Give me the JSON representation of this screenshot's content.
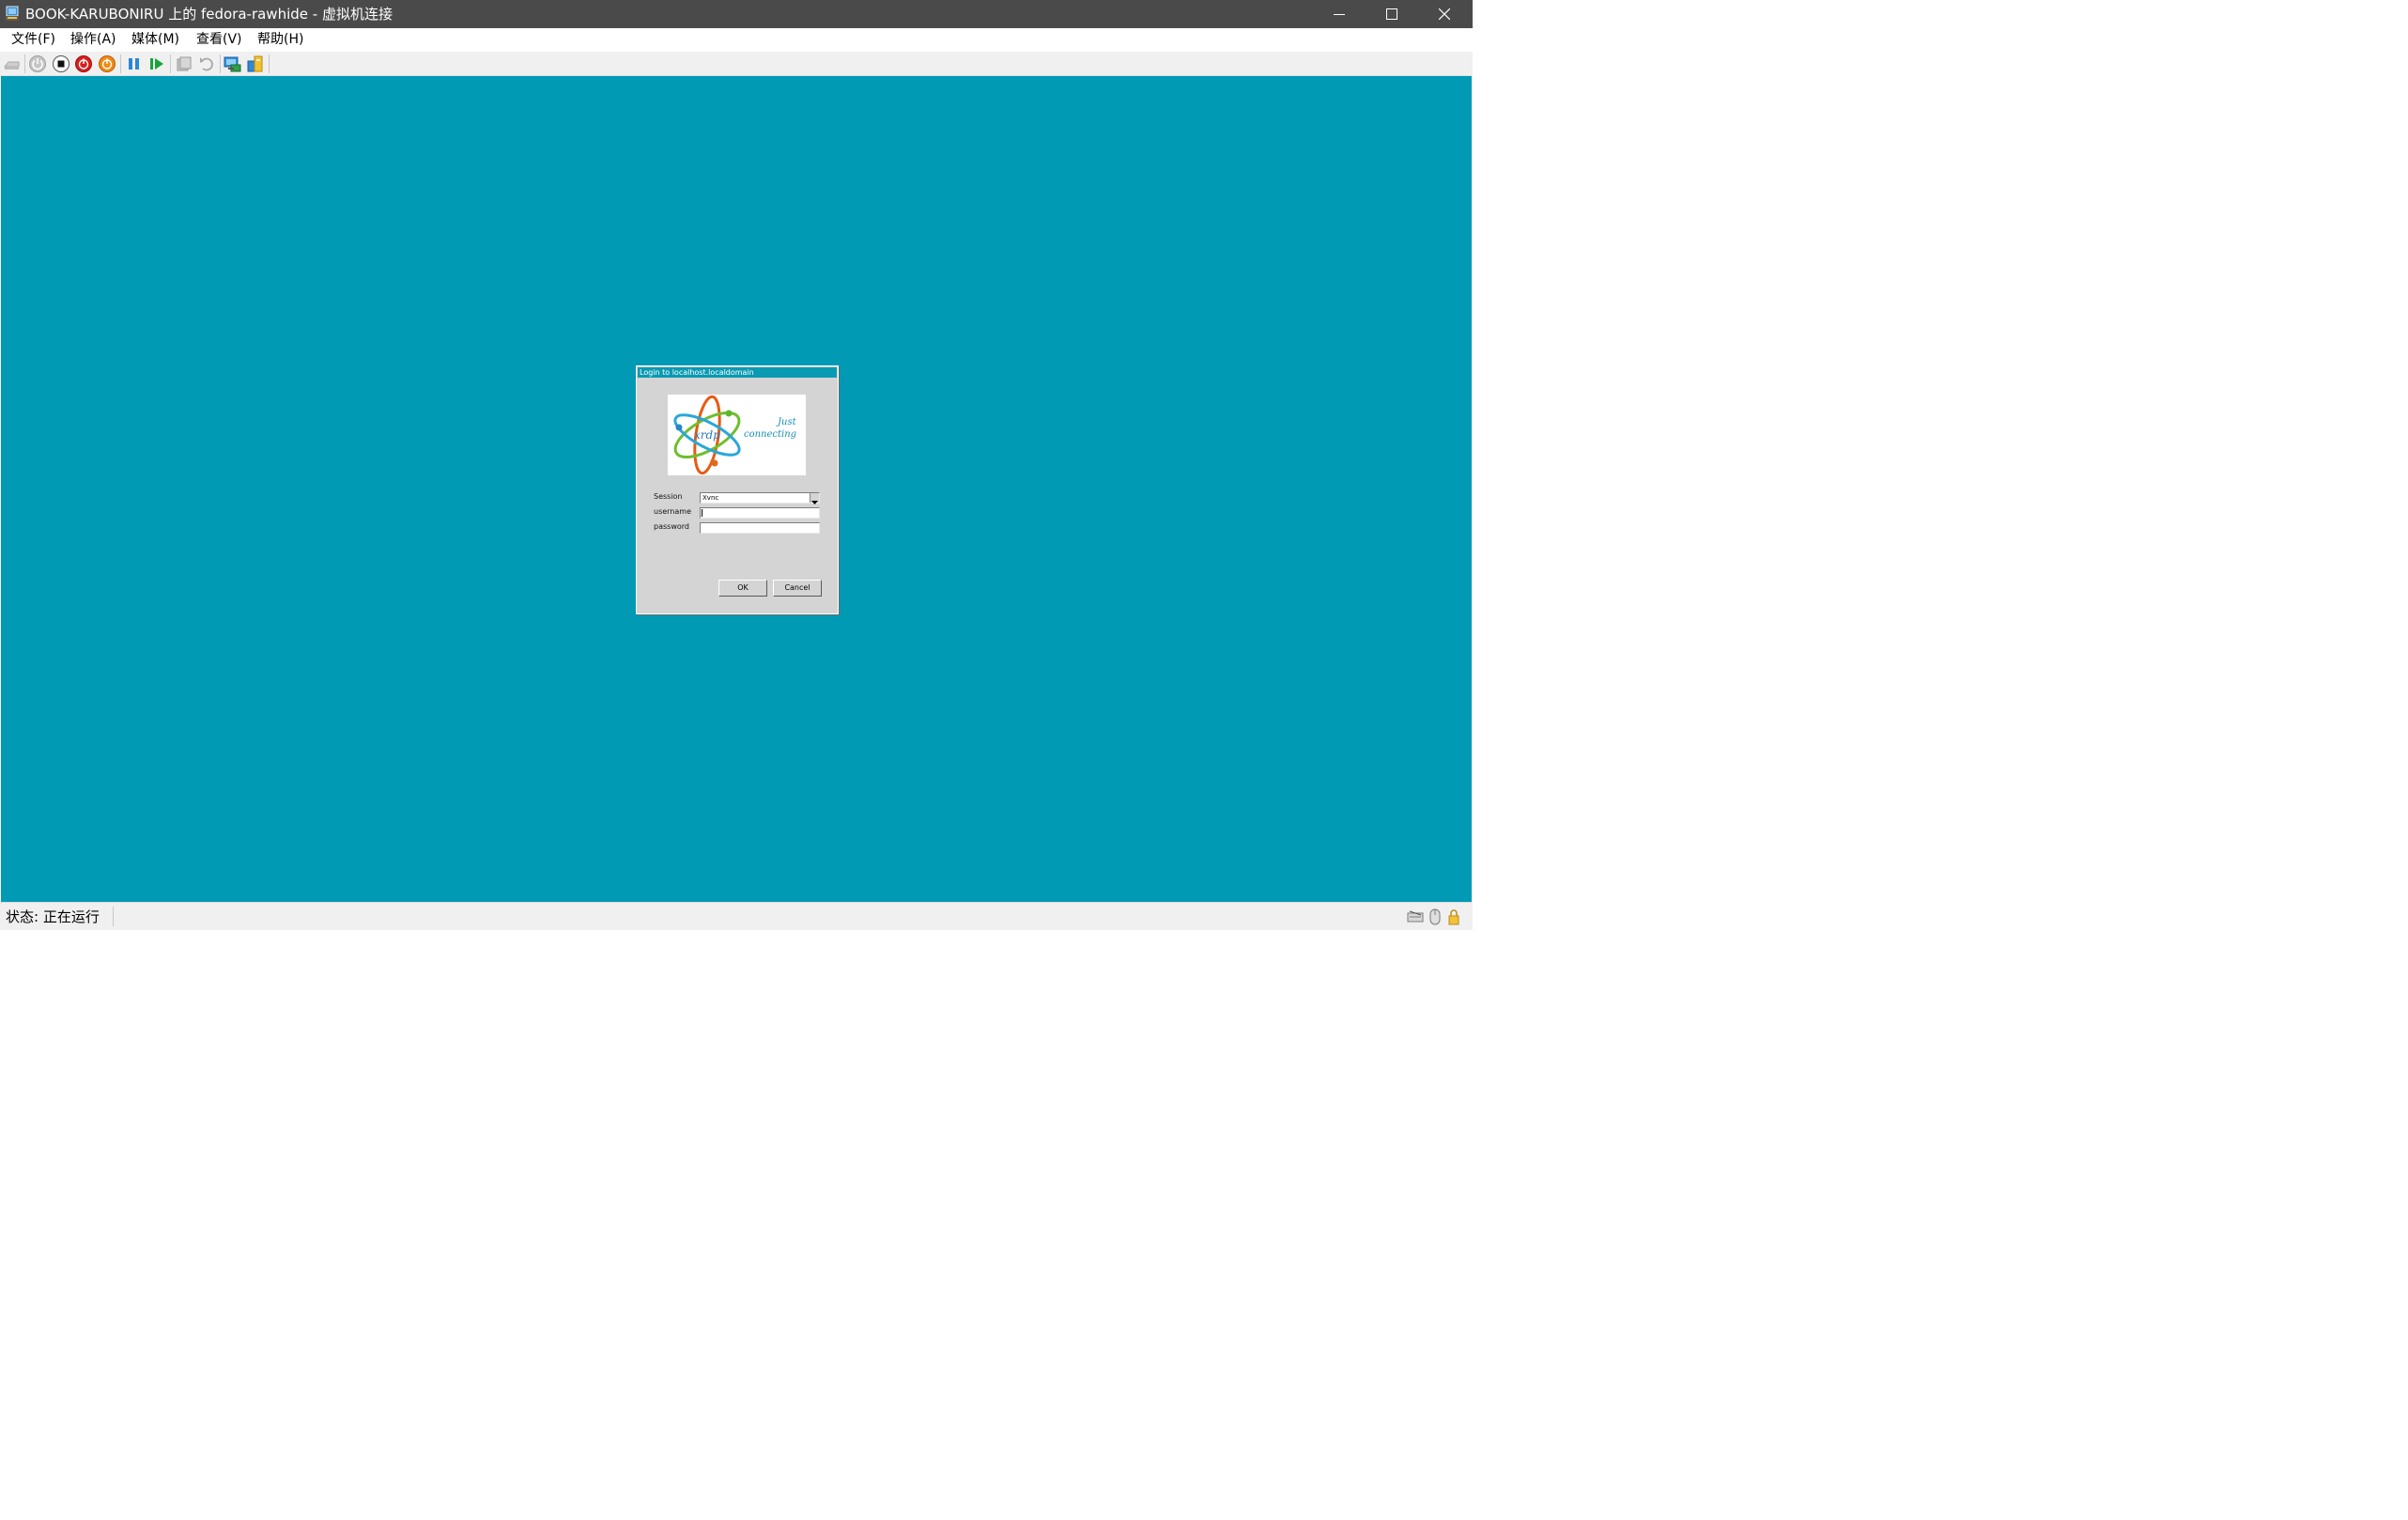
{
  "window": {
    "title": "BOOK-KARUBONIRU 上的 fedora-rawhide - 虚拟机连接",
    "controls": [
      "minimize-icon",
      "maximize-icon",
      "close-icon"
    ]
  },
  "menu": {
    "items": [
      {
        "label": "文件(F)"
      },
      {
        "label": "操作(A)"
      },
      {
        "label": "媒体(M)"
      },
      {
        "label": "查看(V)"
      },
      {
        "label": "帮助(H)"
      }
    ]
  },
  "toolbar": {
    "buttons": [
      {
        "icon": "ctrl-alt-del-icon"
      },
      {
        "icon": "start-icon"
      },
      {
        "icon": "turn-off-icon"
      },
      {
        "icon": "shut-down-icon"
      },
      {
        "icon": "save-icon"
      },
      {
        "icon": "pause-icon"
      },
      {
        "icon": "resume-icon"
      },
      {
        "icon": "checkpoint-icon"
      },
      {
        "icon": "revert-icon"
      },
      {
        "icon": "enhanced-session-icon"
      },
      {
        "icon": "share-icon"
      }
    ]
  },
  "colors": {
    "titlebar": "#4a4a4a",
    "vm_background": "#009ab5",
    "dialog_title": "#0a9ab3",
    "dialog_body": "#d4d4d4"
  },
  "dialog": {
    "title": "Login to localhost.localdomain",
    "logo": {
      "brand": "xrdp",
      "tagline_line1": "Just",
      "tagline_line2": "connecting"
    },
    "session": {
      "label": "Session",
      "value": "Xvnc"
    },
    "username": {
      "label": "username",
      "value": ""
    },
    "password": {
      "label": "password",
      "value": ""
    },
    "ok_label": "OK",
    "cancel_label": "Cancel"
  },
  "status": {
    "text": "状态: 正在运行",
    "icons": [
      "keyboard-icon",
      "mouse-icon",
      "lock-icon"
    ]
  }
}
